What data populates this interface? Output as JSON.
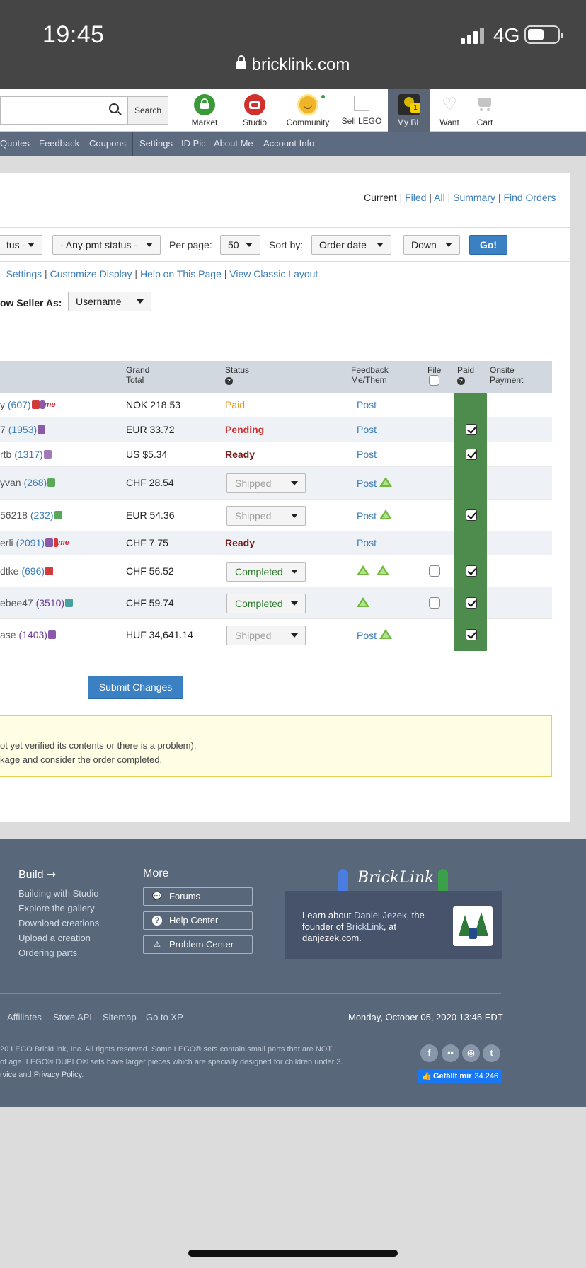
{
  "status_bar": {
    "time": "19:45",
    "network": "4G",
    "url": "bricklink.com"
  },
  "nav": {
    "search_label": "Search",
    "items": [
      {
        "label": "Market",
        "icon": "market-basket-icon",
        "color": "#3a9a3a"
      },
      {
        "label": "Studio",
        "icon": "studio-brick-icon",
        "color": "#d0312d"
      },
      {
        "label": "Community",
        "icon": "community-face-icon",
        "color": "#f0b429"
      },
      {
        "label": "Sell LEGO",
        "icon": "sell-box-icon",
        "color": "#ffffff"
      },
      {
        "label": "My BL",
        "icon": "avatar-icon",
        "badge": "1"
      },
      {
        "label": "Want",
        "icon": "heart-icon"
      },
      {
        "label": "Cart",
        "icon": "cart-icon"
      }
    ]
  },
  "subnav": [
    "Quotes",
    "Feedback",
    "Coupons",
    "Settings",
    "ID Pic",
    "About Me",
    "Account Info"
  ],
  "view_links": {
    "current": "Current",
    "filed": "Filed",
    "all": "All",
    "summary": "Summary",
    "find": "Find Orders"
  },
  "filters": {
    "status_select": "tus -",
    "pmt_select": "- Any pmt status -",
    "per_page_label": "Per page:",
    "per_page": "50",
    "sort_by_label": "Sort by:",
    "sort_by": "Order date",
    "direction": "Down",
    "go": "Go!"
  },
  "settings_links": {
    "prefix": "- ",
    "settings": "Settings",
    "customize": "Customize Display",
    "help": "Help on This Page",
    "classic": "View Classic Layout"
  },
  "seller_as": {
    "label": "ow Seller As:",
    "value": "Username"
  },
  "table": {
    "headers": {
      "grand_total": [
        "Grand",
        "Total"
      ],
      "status": "Status",
      "feedback": [
        "Feedback",
        "Me/Them"
      ],
      "file": "File",
      "paid": "Paid",
      "onsite": [
        "Onsite",
        "Payment"
      ]
    },
    "rows": [
      {
        "name": "y",
        "fb": "(607)",
        "total": "NOK 218.53",
        "status": "Paid",
        "feedback": "Post"
      },
      {
        "name": "7",
        "fb": "(1953)",
        "total": "EUR 33.72",
        "status": "Pending",
        "feedback": "Post"
      },
      {
        "name": "rtb",
        "fb": "(1317)",
        "total": "US $5.34",
        "status": "Ready",
        "feedback": "Post"
      },
      {
        "name": "yvan",
        "fb": "(268)",
        "total": "CHF 28.54",
        "status": "Shipped",
        "feedback": "Post"
      },
      {
        "name": "56218",
        "fb": "(232)",
        "total": "EUR 54.36",
        "status": "Shipped",
        "feedback": "Post"
      },
      {
        "name": "erli",
        "fb": "(2091)",
        "total": "CHF 7.75",
        "status": "Ready",
        "feedback": "Post"
      },
      {
        "name": "dtke",
        "fb": "(696)",
        "total": "CHF 56.52",
        "status": "Completed",
        "feedback": ""
      },
      {
        "name": "ebee47",
        "fb": "(3510)",
        "total": "CHF 59.74",
        "status": "Completed",
        "feedback": ""
      },
      {
        "name": "ase",
        "fb": "(1403)",
        "total": "HUF 34,641.14",
        "status": "Shipped",
        "feedback": "Post"
      }
    ],
    "me_badge": "me"
  },
  "submit": "Submit Changes",
  "notice": [
    "ot yet verified its contents or there is a problem).",
    "kage and consider the order completed."
  ],
  "footer": {
    "build_heading": "Build ➞",
    "build_links": [
      "Building with Studio",
      "Explore the gallery",
      "Download creations",
      "Upload a creation",
      "Ordering parts"
    ],
    "more_heading": "More",
    "more_buttons": [
      "Forums",
      "Help Center",
      "Problem Center"
    ],
    "logo": "BrickLink",
    "promo": {
      "a": "Learn about ",
      "name": "Daniel Jezek",
      "b": ", the founder of ",
      "brand": "BrickLink",
      "c": ", at danjezek.com."
    },
    "bottom_links": [
      "Affiliates",
      "Store API",
      "Sitemap",
      "Go to XP"
    ],
    "date": "Monday, October 05, 2020 13:45 EDT",
    "legal1": "20 LEGO BrickLink, Inc. All rights reserved. Some LEGO® sets contain small parts that are NOT",
    "legal2": "of age. LEGO® DUPLO® sets have larger pieces which are specially designed for children under 3.",
    "legal3a": "rvice",
    "legal3b": " and ",
    "legal3c": "Privacy Policy",
    "legal3d": ".",
    "like": "Gefällt mir",
    "like_count": "34.246"
  }
}
